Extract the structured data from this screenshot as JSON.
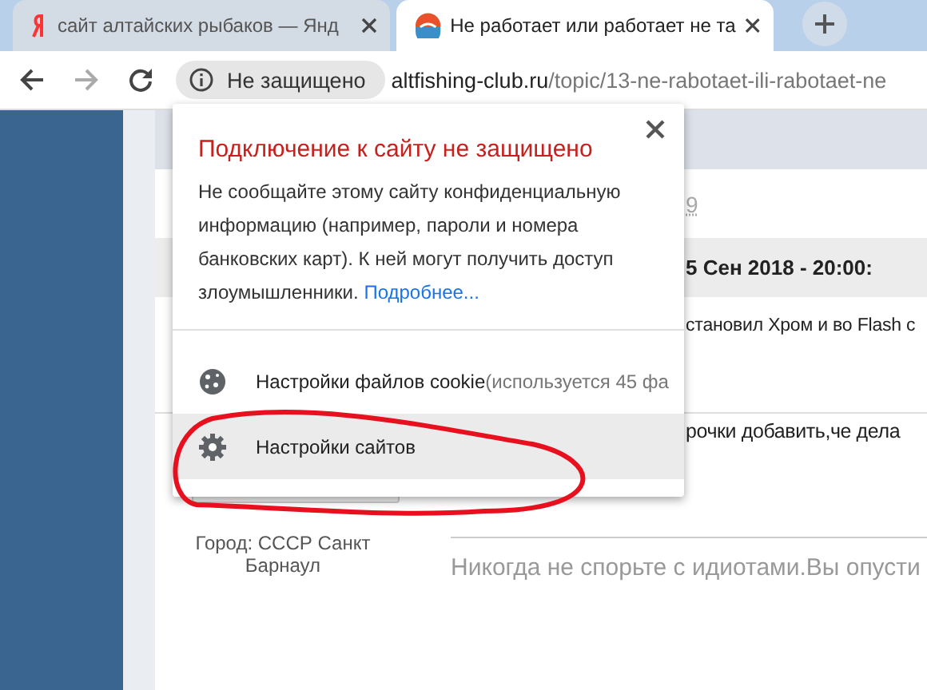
{
  "tabs": [
    {
      "title": "сайт алтайских рыбаков — Янд",
      "kind": "yandex",
      "selected": false
    },
    {
      "title": "Не работает или работает не та",
      "kind": "site",
      "selected": true
    }
  ],
  "toolbar": {
    "security_chip": "Не защищено",
    "url_host": "altfishing-club.ru",
    "url_path": "/topic/13-ne-rabotaet-ili-rabotaet-ne"
  },
  "page": {
    "page_number": "9",
    "post_date": "5 Сен 2018 - 20:00:",
    "post_line_1": "становил Хром и во Flash с",
    "post_line_2": "рочки добавить,че дела",
    "author_city": "Город: СССР Санкт Барнаул",
    "signature": "Никогда не спорьте с идиотами.Вы опусти"
  },
  "popup": {
    "title": "Подключение к сайту не защищено",
    "body": "Не сообщайте этому сайту конфиденциальную информацию (например, пароли и номера банковских карт). К ней могут получить доступ злоумышленники.",
    "link": "Подробнее...",
    "items": [
      {
        "kind": "cookie",
        "label": "Настройки файлов cookie",
        "detail": "(используется 45 фа",
        "selected": false
      },
      {
        "kind": "gear",
        "label": "Настройки сайтов",
        "selected": true
      }
    ]
  },
  "annotation": {
    "kind": "ellipse",
    "color": "#e8101e"
  }
}
